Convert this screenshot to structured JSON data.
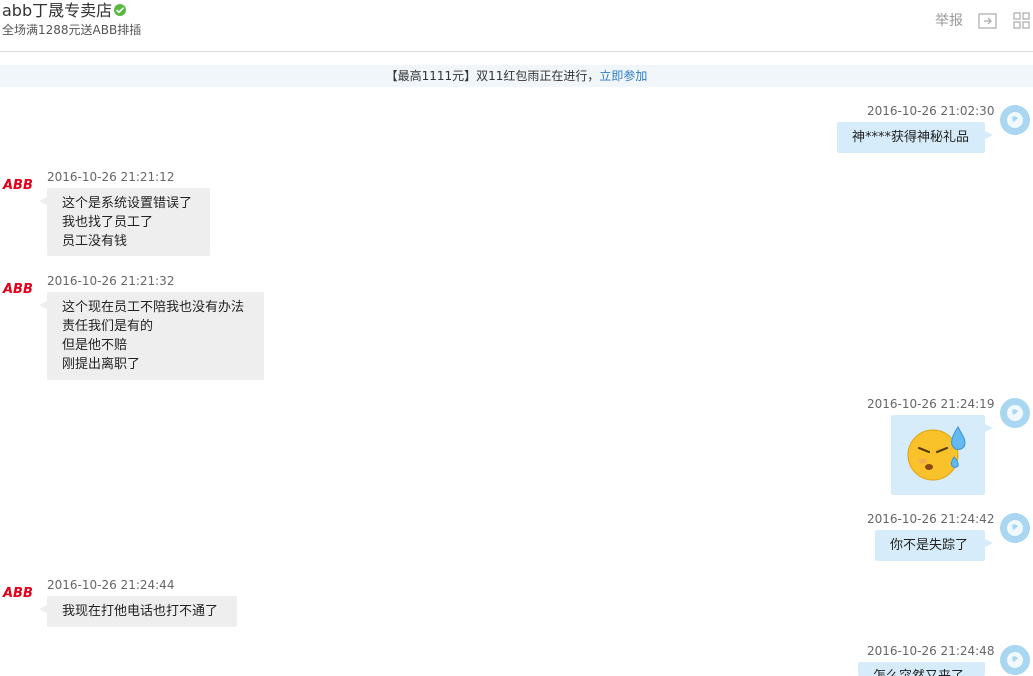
{
  "header": {
    "shop_name": "abb丁晟专卖店",
    "promo": "全场满1288元送ABB排插",
    "report_label": "举报"
  },
  "banner": {
    "text": "【最高1111元】双11红包雨正在进行，",
    "link": "立即参加"
  },
  "brand_logo_text": "ABB",
  "colors": {
    "seller_bubble": "#eeeeee",
    "buyer_bubble": "#d6ecfa",
    "banner_bg": "#f1f6fa",
    "link": "#2a7ec6",
    "abb_red": "#e2001a"
  },
  "messages": [
    {
      "side": "right",
      "time": "2016-10-26 21:02:30",
      "lines": [
        "神****获得神秘礼品"
      ]
    },
    {
      "side": "left",
      "time": "2016-10-26 21:21:12",
      "lines": [
        "这个是系统设置错误了",
        "我也找了员工了",
        "员工没有钱"
      ]
    },
    {
      "side": "left",
      "time": "2016-10-26 21:21:32",
      "lines": [
        "这个现在员工不陪我也没有办法",
        "责任我们是有的",
        "但是他不赔",
        "刚提出离职了"
      ]
    },
    {
      "side": "right",
      "time": "2016-10-26 21:24:19",
      "emoji": "sweat-face-emoji"
    },
    {
      "side": "right",
      "time": "2016-10-26 21:24:42",
      "lines": [
        "你不是失踪了"
      ]
    },
    {
      "side": "left",
      "time": "2016-10-26 21:24:44",
      "lines": [
        "我现在打他电话也打不通了"
      ]
    },
    {
      "side": "right",
      "time": "2016-10-26 21:24:48",
      "lines": [
        "怎么突然又来了"
      ]
    }
  ]
}
